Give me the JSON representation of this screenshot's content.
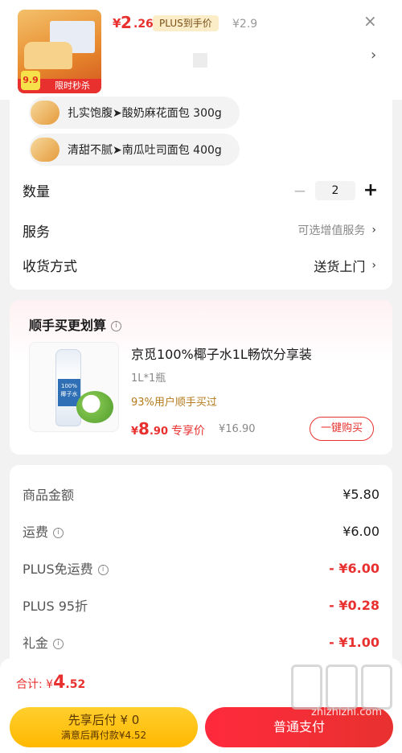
{
  "header": {
    "thumb_badge": "9.9",
    "thumb_band": "限时秒杀",
    "price_currency": "¥",
    "price_int": "2",
    "price_dec": ".26",
    "plus_tag": "PLUS到手价",
    "orig_price": "¥2.9",
    "close_icon": "×",
    "chevron": "›"
  },
  "spec": {
    "options": [
      {
        "label": "扎实饱腹➤酸奶麻花面包 300g"
      },
      {
        "label": "清甜不腻➤南瓜吐司面包 400g"
      }
    ],
    "quantity_label": "数量",
    "quantity_minus": "−",
    "quantity_value": "2",
    "quantity_plus": "+",
    "service_label": "服务",
    "service_value": "可选增值服务",
    "delivery_label": "收货方式",
    "delivery_value": "送货上门",
    "chevron": "›"
  },
  "recommend": {
    "title": "顺手买更划算",
    "info_icon": "i",
    "image_text": "100% 椰子水",
    "product_name": "京觅100%椰子水1L畅饮分享装",
    "product_spec": "1L*1瓶",
    "sold_text": "93%用户顺手买过",
    "price_currency": "¥",
    "price_int": "8",
    "price_dec": ".90",
    "price_tag": "专享价",
    "orig_price": "¥16.90",
    "buy_button": "一键购买"
  },
  "fees": {
    "rows": [
      {
        "label": "商品金额",
        "value": "¥5.80",
        "info": false,
        "red": false
      },
      {
        "label": "运费",
        "value": "¥6.00",
        "info": true,
        "red": false
      },
      {
        "label": "PLUS免运费",
        "value": "- ¥6.00",
        "info": true,
        "red": true
      },
      {
        "label": "PLUS 95折",
        "value": "- ¥0.28",
        "info": false,
        "red": true
      },
      {
        "label": "礼金",
        "value": "- ¥1.00",
        "info": true,
        "red": true
      }
    ]
  },
  "footer": {
    "total_label": "合计: ¥",
    "total_int": "4",
    "total_dec": ".52",
    "later_line1": "先享后付 ¥ 0",
    "later_line2": "满意后再付款¥4.52",
    "pay_button": "普通支付",
    "watermark": "zhizhizhi.com"
  },
  "colors": {
    "accent": "#e8312f",
    "plus_gold": "#fbedc8",
    "later_button": "#ffb800"
  },
  "icons": {
    "close": "close-icon",
    "chevron": "chevron-right-icon",
    "info": "info-icon"
  }
}
